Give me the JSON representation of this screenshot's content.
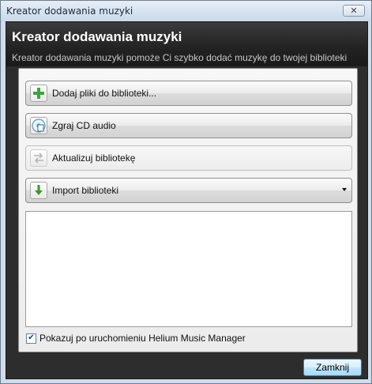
{
  "window": {
    "title": "Kreator dodawania muzyki",
    "close_glyph": "☒"
  },
  "header": {
    "title": "Kreator dodawania muzyki",
    "subtitle": "Kreator dodawania muzyki pomoże Ci szybko dodać muzykę do twojej biblioteki"
  },
  "actions": {
    "add_files": {
      "label": "Dodaj pliki do biblioteki...",
      "icon": "plus-icon"
    },
    "rip_cd": {
      "label": "Zgraj CD audio",
      "icon": "cd-icon"
    },
    "update_library": {
      "label": "Aktualizuj bibliotekę",
      "icon": "sync-icon",
      "disabled": true
    },
    "import_library": {
      "label": "Import biblioteki",
      "icon": "download-arrow-icon"
    }
  },
  "options": {
    "show_on_startup_label": "Pokazuj po uruchomieniu Helium Music Manager",
    "show_on_startup_checked": true
  },
  "footer": {
    "close_label": "Zamknij"
  },
  "colors": {
    "accent": "#3c7fb1",
    "header_bg": "#2d2d2d",
    "plus_green": "#3aa640",
    "arrow_green": "#3a9a2a"
  }
}
